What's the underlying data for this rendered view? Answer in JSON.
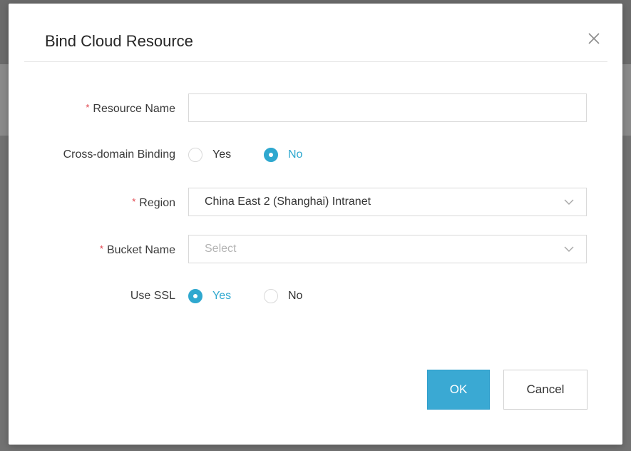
{
  "dialog": {
    "title": "Bind Cloud Resource",
    "close_icon": "close-icon"
  },
  "form": {
    "resource_name": {
      "label": "Resource Name",
      "required_mark": "*",
      "value": "",
      "placeholder": ""
    },
    "cross_domain": {
      "label": "Cross-domain Binding",
      "options": [
        {
          "label": "Yes",
          "checked": false
        },
        {
          "label": "No",
          "checked": true
        }
      ]
    },
    "region": {
      "label": "Region",
      "required_mark": "*",
      "selected": "China East 2 (Shanghai) Intranet",
      "icon": "chevron-down-icon"
    },
    "bucket_name": {
      "label": "Bucket Name",
      "required_mark": "*",
      "placeholder": "Select",
      "icon": "chevron-down-icon"
    },
    "use_ssl": {
      "label": "Use SSL",
      "options": [
        {
          "label": "Yes",
          "checked": true
        },
        {
          "label": "No",
          "checked": false
        }
      ]
    }
  },
  "footer": {
    "ok_label": "OK",
    "cancel_label": "Cancel"
  },
  "colors": {
    "accent": "#2fa8cf",
    "required": "#e0414a",
    "ok_button": "#3aa9d3"
  }
}
